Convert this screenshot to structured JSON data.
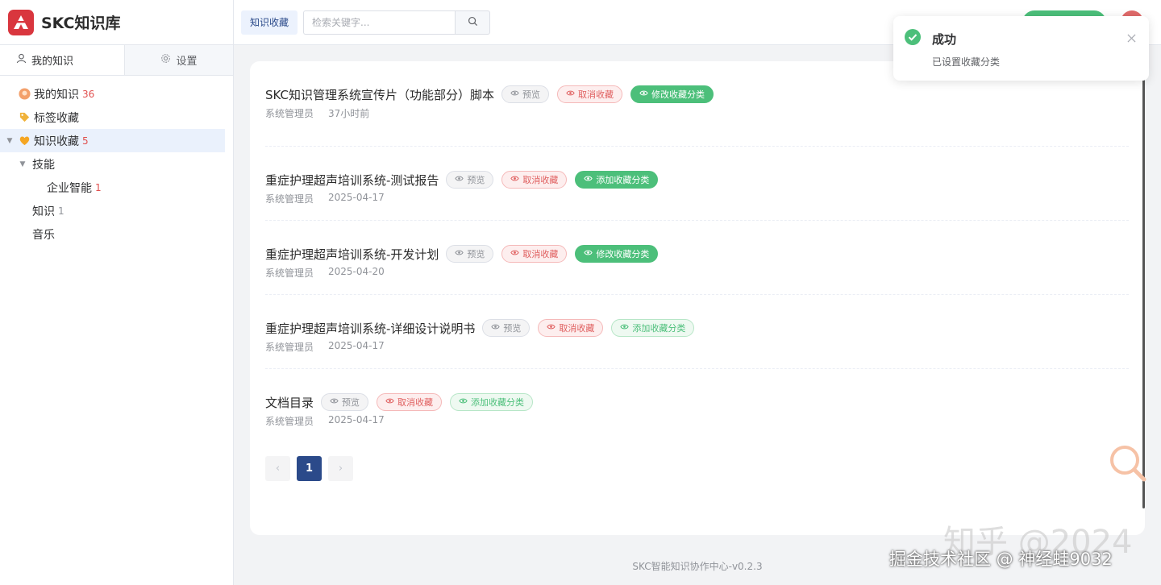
{
  "app": {
    "name": "SKC知识库"
  },
  "sidebar": {
    "tabs": [
      {
        "label": "我的知识",
        "icon": "user-icon"
      },
      {
        "label": "设置",
        "icon": "gear-icon"
      }
    ],
    "tree": {
      "my_knowledge": {
        "label": "我的知识",
        "count": "36"
      },
      "tag_favorites": {
        "label": "标签收藏"
      },
      "knowledge_favorites": {
        "label": "知识收藏",
        "count": "5"
      },
      "skills": {
        "label": "技能"
      },
      "enterprise_ai": {
        "label": "企业智能",
        "count": "1"
      },
      "knowledge": {
        "label": "知识",
        "count": "1"
      },
      "music": {
        "label": "音乐"
      }
    }
  },
  "topbar": {
    "crumb": "知识收藏",
    "search_placeholder": "检索关键字..."
  },
  "actions": {
    "preview": "预览",
    "cancel": "取消收藏",
    "edit_category": "修改收藏分类",
    "add_category": "添加收藏分类"
  },
  "items": [
    {
      "title": "SKC知识管理系统宣传片（功能部分）脚本",
      "author": "系统管理员",
      "time": "37小时前",
      "category_action": "edit"
    },
    {
      "title": "重症护理超声培训系统-测试报告",
      "author": "系统管理员",
      "time": "2025-04-17",
      "category_action": "add_solid"
    },
    {
      "title": "重症护理超声培训系统-开发计划",
      "author": "系统管理员",
      "time": "2025-04-20",
      "category_action": "edit"
    },
    {
      "title": "重症护理超声培训系统-详细设计说明书",
      "author": "系统管理员",
      "time": "2025-04-17",
      "category_action": "add"
    },
    {
      "title": "文档目录",
      "author": "系统管理员",
      "time": "2025-04-17",
      "category_action": "add"
    }
  ],
  "pagination": {
    "prev": "‹",
    "current": "1",
    "next": "›"
  },
  "footer": {
    "text": "SKC智能知识协作中心-v0.2.3"
  },
  "toast": {
    "title": "成功",
    "message": "已设置收藏分类"
  },
  "watermark": {
    "line1": "知乎 @2024",
    "line2": "掘金技术社区 @ 神经蛙9032"
  },
  "colors": {
    "brand": "#d9363e",
    "primary": "#2b4a8a",
    "success": "#4cbf7a",
    "danger": "#e06060"
  }
}
